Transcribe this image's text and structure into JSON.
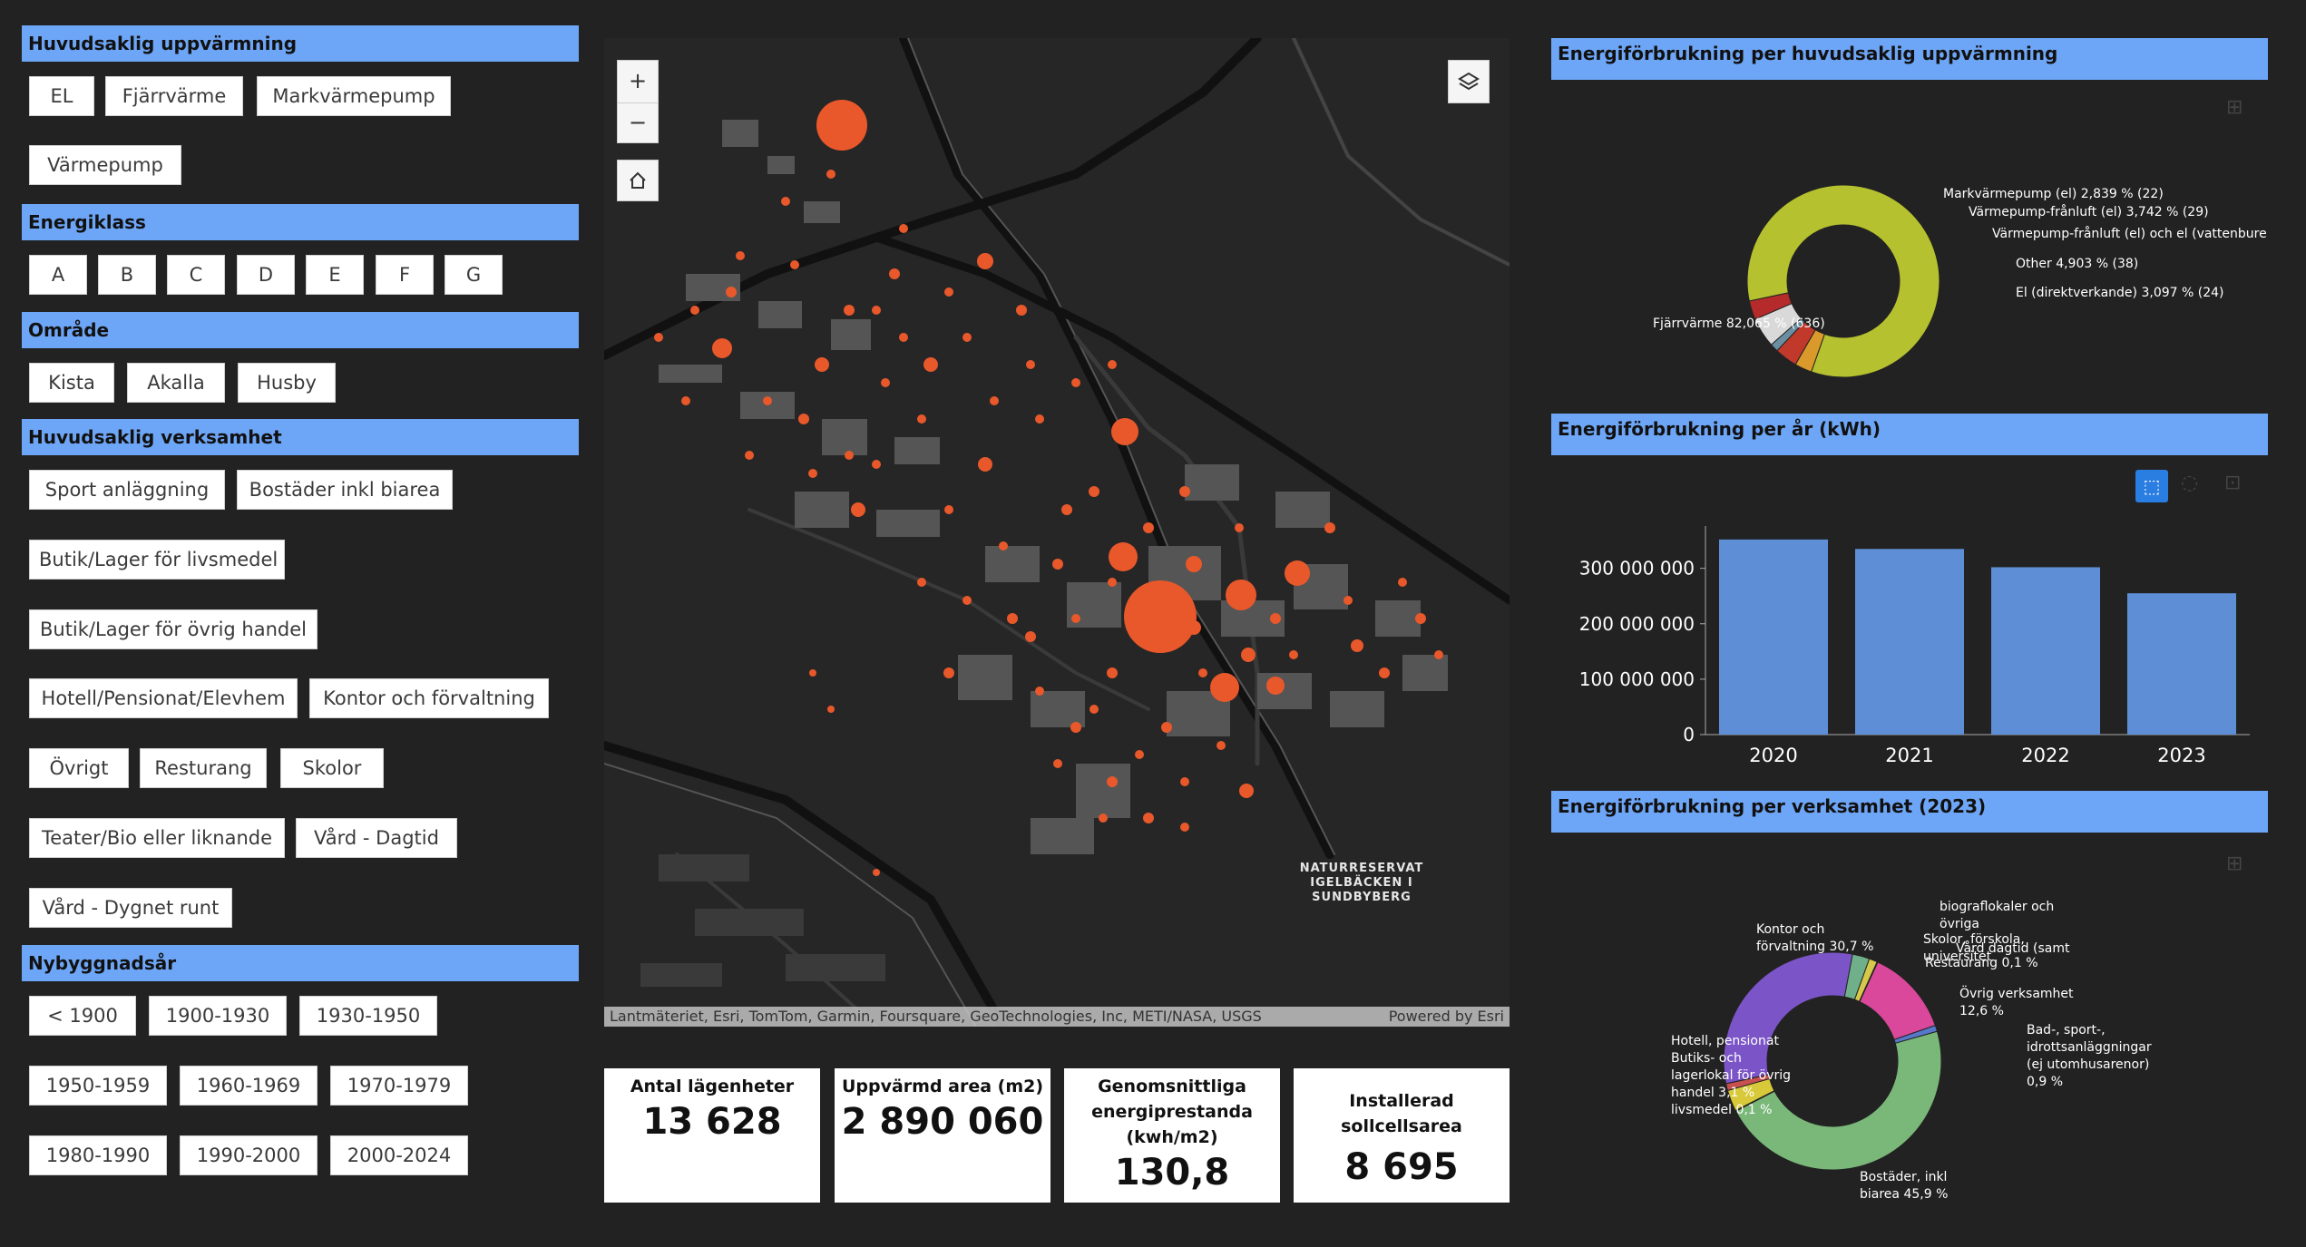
{
  "filters": {
    "heating": {
      "title": "Huvudsaklig uppvärmning",
      "options": [
        "EL",
        "Fjärrvärme",
        "Markvärmepump",
        "Värmepump"
      ]
    },
    "energy_class": {
      "title": "Energiklass",
      "options": [
        "A",
        "B",
        "C",
        "D",
        "E",
        "F",
        "G"
      ]
    },
    "area": {
      "title": "Område",
      "options": [
        "Kista",
        "Akalla",
        "Husby"
      ]
    },
    "activity": {
      "title": "Huvudsaklig verksamhet",
      "options": [
        "Sport anläggning",
        "Bostäder inkl biarea",
        "Butik/Lager för livsmedel",
        "Butik/Lager för övrig handel",
        "Hotell/Pensionat/Elevhem",
        "Kontor och förvaltning",
        "Övrigt",
        "Resturang",
        "Skolor",
        "Teater/Bio eller liknande",
        "Vård - Dagtid",
        "Vård - Dygnet runt"
      ]
    },
    "build_year": {
      "title": "Nybyggnadsår",
      "options": [
        "< 1900",
        "1900-1930",
        "1930-1950",
        "1950-1959",
        "1960-1969",
        "1970-1979",
        "1980-1990",
        "1990-2000",
        "2000-2024"
      ]
    }
  },
  "map": {
    "zoom_in": "+",
    "zoom_out": "−",
    "home_icon": "home-icon",
    "layers_icon": "layers-icon",
    "attribution": "Lantmäteriet, Esri, TomTom, Garmin, Foursquare, GeoTechnologies, Inc, METI/NASA, USGS",
    "powered_by": "Powered by Esri",
    "place_label": [
      "NATURRESERVAT",
      "IGELBÄCKEN I",
      "SUNDBYBERG"
    ],
    "marker_color": "#e8582a"
  },
  "kpis": [
    {
      "label": "Antal lägenheter",
      "value": "13 628"
    },
    {
      "label": "Uppvärmd area (m2)",
      "value": "2 890 060"
    },
    {
      "label": "Genomsnittliga energiprestanda (kwh/m2)",
      "value": "130,8"
    },
    {
      "label": "Installerad sollcellsarea",
      "value": "8 695"
    }
  ],
  "chart_data": [
    {
      "type": "pie",
      "title": "Energiförbrukning per huvudsaklig uppvärmning",
      "slices": [
        {
          "label": "Fjärrvärme 82,065 % (636)",
          "value": 82.065,
          "color": "#b5c12e"
        },
        {
          "label": "Markvärmepump (el) 2,839 % (22)",
          "value": 2.839,
          "color": "#d99a2b"
        },
        {
          "label": "Värmepump-frånluft (el) 3,742 % (29)",
          "value": 3.742,
          "color": "#c0392b"
        },
        {
          "label": "Värmepump-frånluft (el) och el (vattenburen)",
          "value": 1.354,
          "color": "#6a8fa3"
        },
        {
          "label": "Other 4,903 % (38)",
          "value": 4.903,
          "color": "#d9d9d9"
        },
        {
          "label": "El (direktverkande) 3,097 % (24)",
          "value": 3.097,
          "color": "#b52a2a"
        }
      ]
    },
    {
      "type": "bar",
      "title": "Energiförbrukning per år (kWh)",
      "categories": [
        "2020",
        "2021",
        "2022",
        "2023"
      ],
      "values": [
        352000000,
        335000000,
        302000000,
        255000000
      ],
      "ylim": [
        0,
        360000000
      ],
      "yticks": [
        0,
        100000000,
        200000000,
        300000000
      ],
      "ytick_labels": [
        "0",
        "100 000 000",
        "200 000 000",
        "300 000 000"
      ],
      "color": "#5e8fd6"
    },
    {
      "type": "pie",
      "title": "Energiförbrukning per verksamhet (2023)",
      "slices": [
        {
          "label": "Kontor och förvaltning 30,7 %",
          "value": 30.7,
          "color": "#7b55c7"
        },
        {
          "label": "Skolor, förskola, universitet",
          "value": 2.5,
          "color": "#6fb08a"
        },
        {
          "label": "Vård dagtid",
          "value": 1.2,
          "color": "#d6c84a"
        },
        {
          "label": "Restaurang 0,1 %",
          "value": 0.1,
          "color": "#e07b3a"
        },
        {
          "label": "Övrig verksamhet 12,6 %",
          "value": 12.6,
          "color": "#d9489b"
        },
        {
          "label": "Bad-, sport-, idrottsanläggningar (ej utomhusarenor) 0,9 %",
          "value": 0.9,
          "color": "#5578c9"
        },
        {
          "label": "Bostäder, inkl biarea 45,9 %",
          "value": 45.9,
          "color": "#7ab87a"
        },
        {
          "label": "Butik och lager för livsmedel 0,1 %",
          "value": 0.1,
          "color": "#8aa0c8"
        },
        {
          "label": "Butik och lager för övrig handel 3,1 %",
          "value": 3.1,
          "color": "#d8c93a"
        },
        {
          "label": "Hotell, pensionat 1 %",
          "value": 1.0,
          "color": "#c85050"
        }
      ],
      "annotations": {
        "kontor": "Kontor och förvaltning 30,7 %",
        "ovrig": "Övrig verksamhet 12,6 %",
        "bad": "Bad-, sport-, idrottsanläggningar (ej utomhusarenor) 0,9 %",
        "bostader": "Bostäder, inkl biarea 45,9 %",
        "hotell": "Hotell, pensionat och elevhem 1 %",
        "butik": "Butiks- och lagerlokal för övrig handel 3,1 %",
        "livs": "Butik/Lager för livsmedel 0,1 %",
        "skolor": "Skolor, förskola, universitet 2,5 %",
        "restaurang": "Restaurang 0,1 %",
        "vard": "Vård dagtid (samt övriga lokaler)",
        "bio": "biograflokaler och övriga 0,1 %"
      }
    }
  ]
}
